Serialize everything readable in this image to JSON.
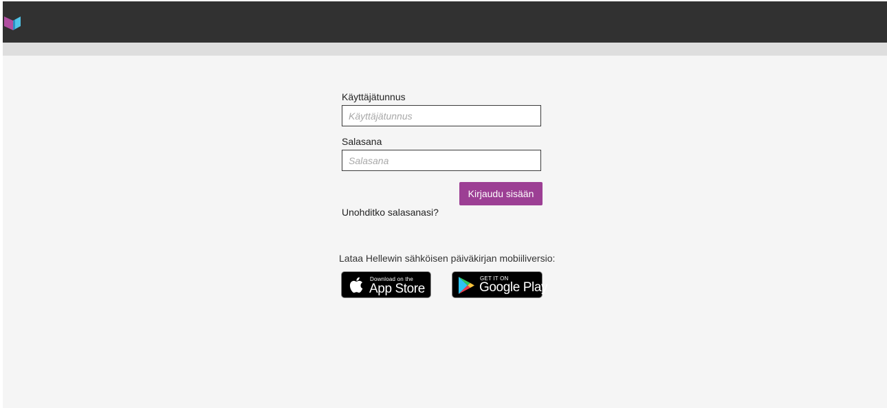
{
  "brand": {
    "logo_icon": "book-logo-icon",
    "colors": {
      "topbar": "#313131",
      "accent": "#9c3f94",
      "logo_left": "#b04ea0",
      "logo_right": "#4fc3e8"
    }
  },
  "login": {
    "username_label": "Käyttäjätunnus",
    "username_placeholder": "Käyttäjätunnus",
    "username_value": "",
    "password_label": "Salasana",
    "password_placeholder": "Salasana",
    "password_value": "",
    "submit_label": "Kirjaudu sisään",
    "forgot_link": "Unohditko salasanasi?"
  },
  "mobile": {
    "promo_text": "Lataa Hellewin sähköisen päiväkirjan mobiiliversio:",
    "app_store": {
      "icon": "apple-icon",
      "small_text": "Download on the",
      "big_text": "App Store"
    },
    "google_play": {
      "icon": "google-play-icon",
      "small_text": "GET IT ON",
      "big_text": "Google Play"
    }
  }
}
